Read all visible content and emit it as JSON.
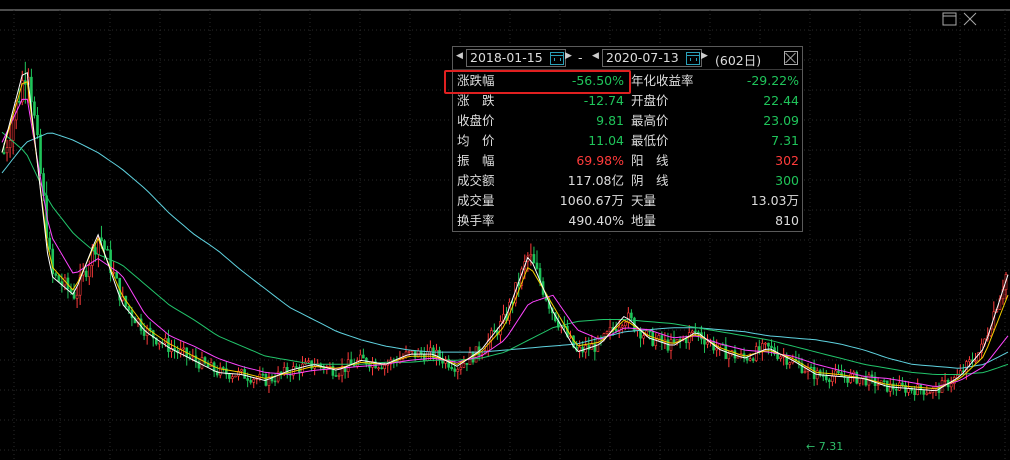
{
  "window": {
    "restore_icon": "restore-icon",
    "close_icon": "close-icon"
  },
  "colors": {
    "background": "#000000",
    "up": "#ff3b3b",
    "down": "#1fc45a",
    "ma5": "#ffffff",
    "ma10": "#f5d000",
    "ma20": "#ff44ff",
    "ma60": "#22c56b",
    "ma120": "#5fd3e0"
  },
  "popup": {
    "prev_arrow_left": "◀",
    "next_arrow_left": "▶",
    "start_date": "2018-01-15",
    "dash": "-",
    "prev_arrow_right": "◀",
    "next_arrow_right": "▶",
    "end_date": "2020-07-13",
    "days": "(602日)",
    "rows": [
      {
        "l1": "涨跌幅",
        "v1": "-56.50%",
        "c1": "g",
        "l2": "年化收益率",
        "v2": "-29.22%",
        "c2": "g"
      },
      {
        "l1": "涨　跌",
        "v1": "-12.74",
        "c1": "g",
        "l2": "开盘价",
        "v2": "22.44",
        "c2": "g"
      },
      {
        "l1": "收盘价",
        "v1": "9.81",
        "c1": "g",
        "l2": "最高价",
        "v2": "23.09",
        "c2": "g"
      },
      {
        "l1": "均　价",
        "v1": "11.04",
        "c1": "g",
        "l2": "最低价",
        "v2": "7.31",
        "c2": "g"
      },
      {
        "l1": "振　幅",
        "v1": "69.98%",
        "c1": "r",
        "l2": "阳　线",
        "v2": "302",
        "c2": "r"
      },
      {
        "l1": "成交额",
        "v1": "117.08亿",
        "c1": "w",
        "l2": "阴　线",
        "v2": "300",
        "c2": "g"
      },
      {
        "l1": "成交量",
        "v1": "1060.67万",
        "c1": "w",
        "l2": "天量",
        "v2": "13.03万",
        "c2": "w"
      },
      {
        "l1": "换手率",
        "v1": "490.40%",
        "c1": "w",
        "l2": "地量",
        "v2": "810",
        "c2": "w"
      }
    ]
  },
  "chart_data": {
    "type": "line",
    "period_start": "2018-01-15",
    "period_end": "2020-07-13",
    "low_marker": "7.31",
    "series": [
      {
        "name": "",
        "color": "#5fd3e0",
        "values": [
          20,
          21.5,
          22,
          21.6,
          21,
          20.2,
          19.2,
          18,
          17,
          16.2,
          15.2,
          14.3,
          13.4,
          12.8,
          12.2,
          11.8,
          11.5,
          11.3,
          11.2,
          11.2,
          11.2,
          11.3,
          11.4,
          11.5,
          11.6,
          11.9,
          12.2,
          12.3,
          12.4,
          12.4,
          12.3,
          12.2,
          12.0,
          11.9,
          11.8,
          11.6,
          11.3,
          10.9,
          10.6,
          10.5,
          10.4,
          10.6,
          11.2
        ]
      },
      {
        "name": "",
        "color": "#22c56b",
        "values": [
          22,
          21,
          18.5,
          17,
          16,
          15.5,
          14.5,
          13.5,
          12.8,
          12.0,
          11.5,
          11.0,
          10.8,
          10.6,
          10.6,
          10.6,
          10.7,
          10.7,
          10.8,
          10.8,
          10.9,
          11.2,
          11.8,
          12.4,
          12.7,
          12.8,
          12.8,
          12.7,
          12.6,
          12.4,
          12.2,
          12.0,
          11.8,
          11.5,
          11.2,
          10.9,
          10.6,
          10.4,
          10.2,
          10.1,
          10.1,
          10.2,
          10.6
        ]
      },
      {
        "name": "",
        "color": "#ff44ff",
        "values": [
          21.5,
          24,
          17,
          15,
          15.8,
          15,
          13,
          12,
          11.5,
          10.9,
          10.5,
          10.2,
          10.1,
          10.3,
          10.4,
          10.5,
          10.6,
          10.8,
          10.9,
          10.7,
          11,
          11.8,
          13.6,
          14,
          12.3,
          11.8,
          12.4,
          12.3,
          11.9,
          12,
          11.6,
          11.3,
          11.2,
          11.0,
          10.6,
          10.3,
          10.0,
          9.9,
          9.7,
          9.5,
          9.8,
          10.5,
          12.0
        ]
      },
      {
        "name": "",
        "color": "#f5d000",
        "values": [
          21,
          25,
          15.5,
          14.2,
          16.8,
          14,
          12.4,
          11.6,
          11.0,
          10.4,
          10.2,
          9.9,
          10.2,
          10.5,
          10.4,
          10.7,
          10.6,
          11.0,
          11.0,
          10.6,
          11.2,
          12.5,
          15.5,
          13.5,
          11.5,
          11.7,
          12.8,
          12.0,
          11.6,
          12.1,
          11.4,
          11.0,
          11.3,
          10.9,
          10.2,
          10.1,
          9.9,
          9.6,
          9.5,
          9.4,
          9.9,
          11.0,
          14.0
        ]
      },
      {
        "name": "",
        "color": "#ffffff",
        "values": [
          21,
          25.5,
          15,
          14,
          17,
          13.6,
          12.2,
          11.4,
          10.8,
          10.2,
          10.1,
          9.8,
          10.3,
          10.6,
          10.3,
          10.8,
          10.6,
          11.1,
          11.1,
          10.5,
          11.3,
          12.8,
          16,
          13.2,
          11.2,
          11.6,
          13,
          11.9,
          11.5,
          12.2,
          11.3,
          10.9,
          11.4,
          10.8,
          10.1,
          10.0,
          9.9,
          9.5,
          9.4,
          9.3,
          10.0,
          11.4,
          15.0
        ]
      }
    ]
  }
}
